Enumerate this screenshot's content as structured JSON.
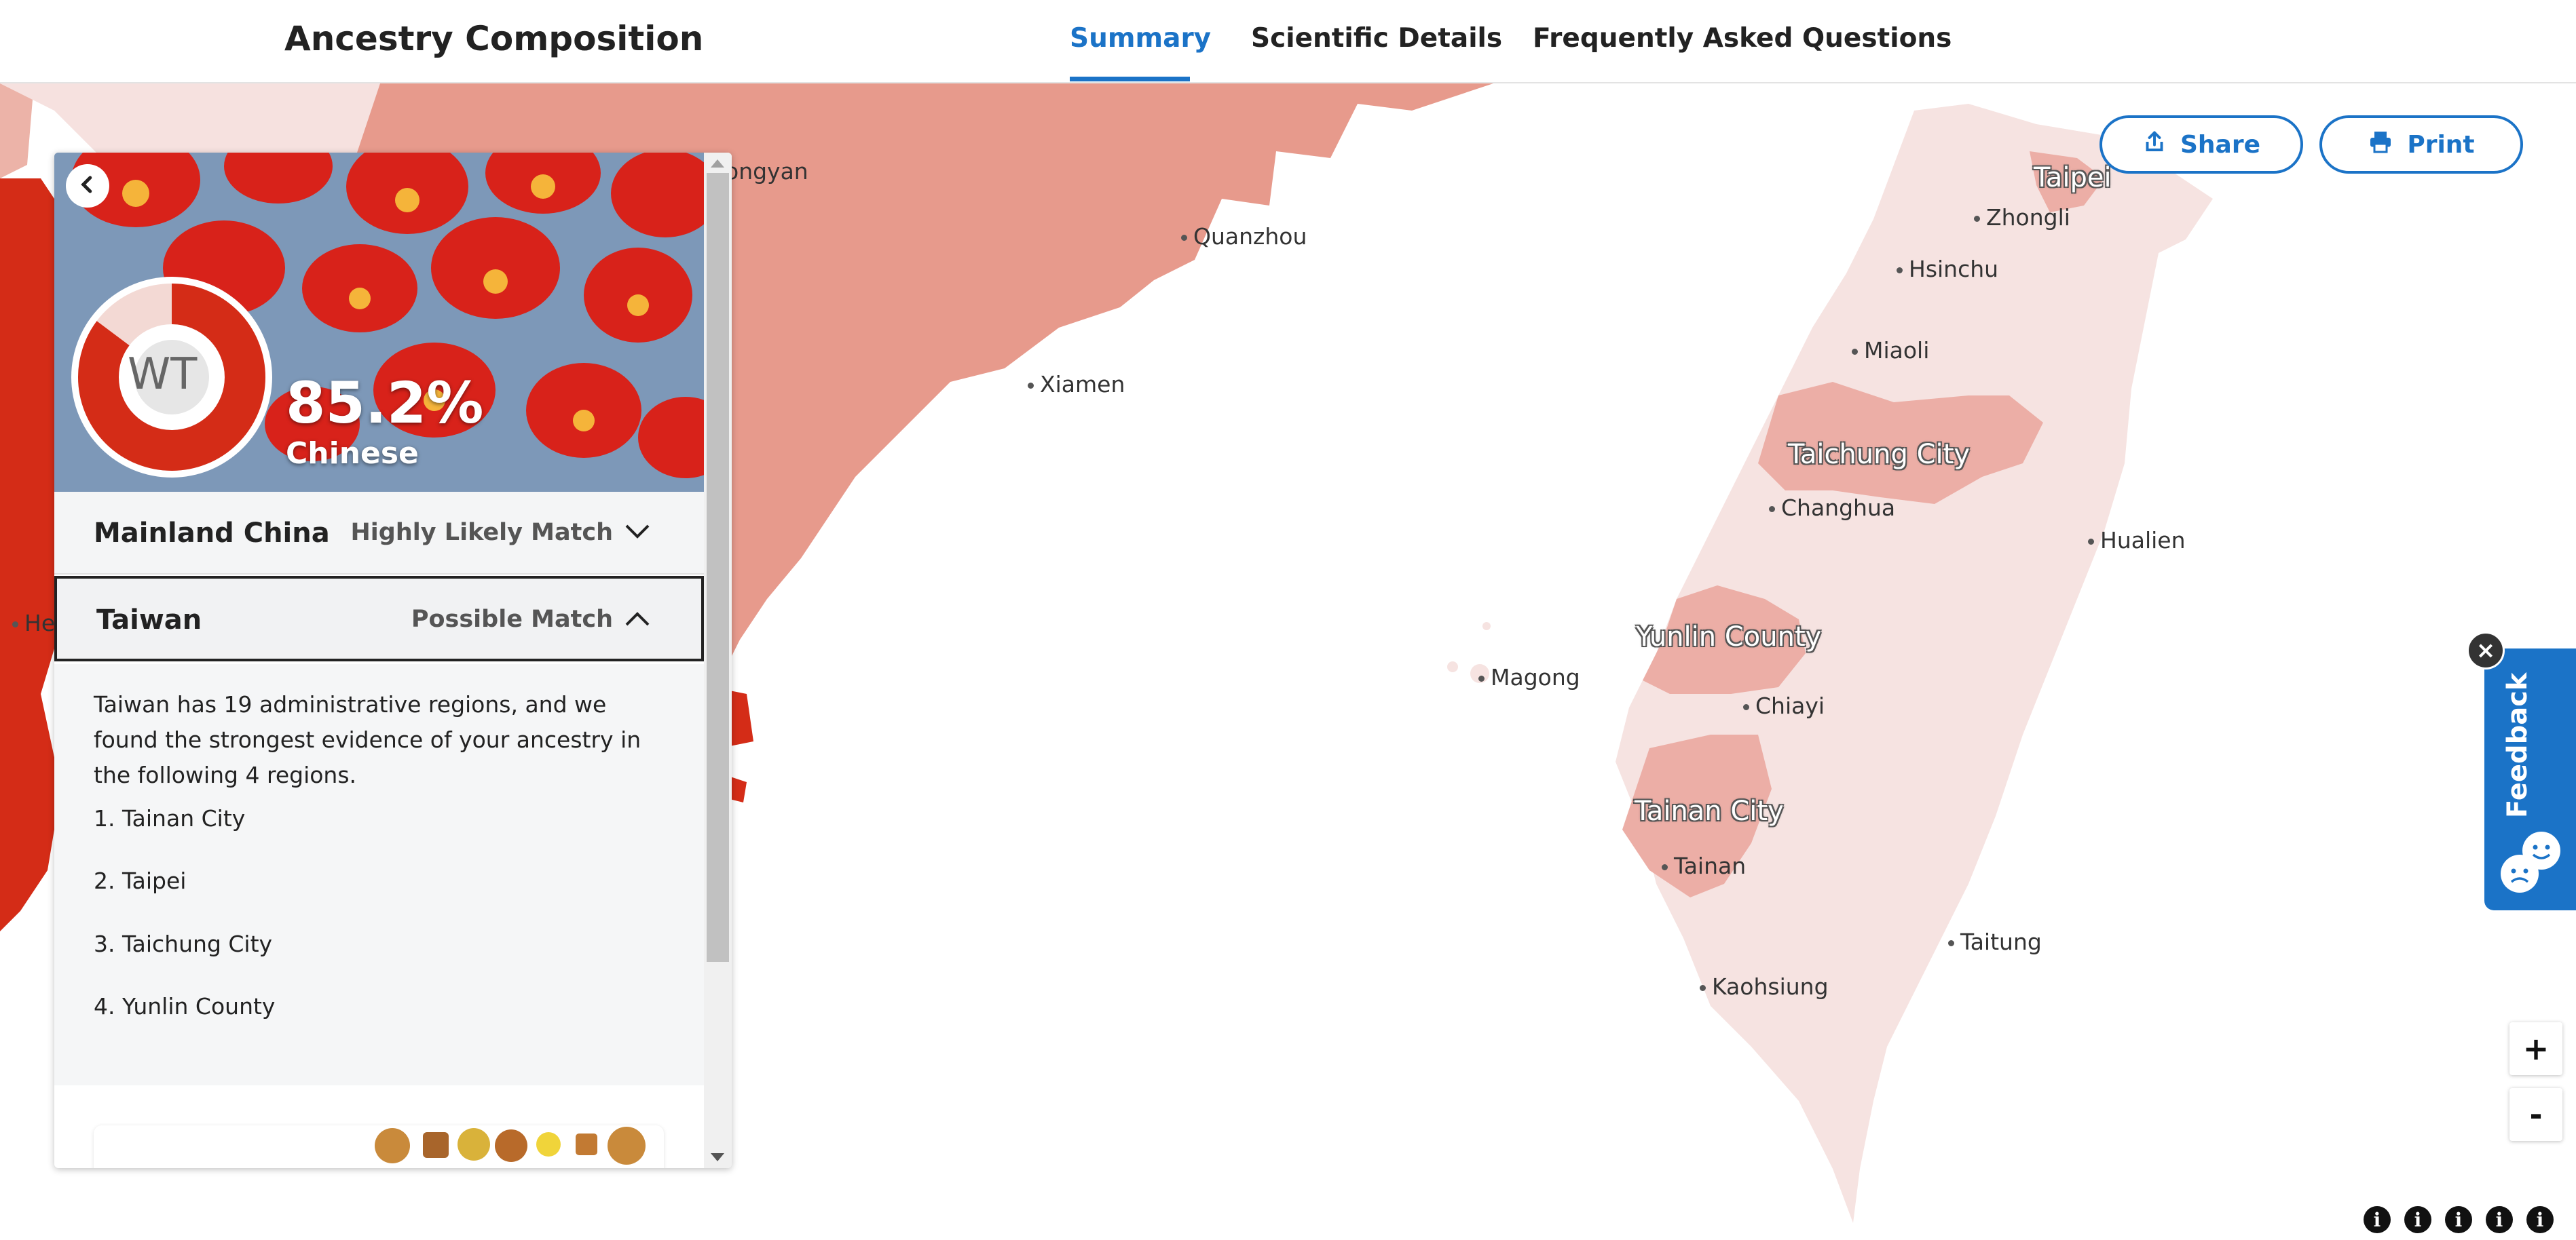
{
  "header": {
    "title": "Ancestry Composition",
    "tabs": [
      {
        "label": "Summary",
        "active": true
      },
      {
        "label": "Scientific Details",
        "active": false
      },
      {
        "label": "Frequently Asked Questions",
        "active": false
      }
    ]
  },
  "actions": {
    "share_label": "Share",
    "print_label": "Print"
  },
  "panel": {
    "avatar_initials": "WT",
    "percentage": "85.2%",
    "population": "Chinese",
    "percentage_value": 0.852,
    "rows": [
      {
        "name": "Mainland China",
        "match": "Highly Likely Match",
        "expanded": false
      },
      {
        "name": "Taiwan",
        "match": "Possible Match",
        "expanded": true
      }
    ],
    "taiwan_detail": {
      "description": "Taiwan has 19 administrative regions, and we found the strongest evidence of your ancestry in the following 4 regions.",
      "regions": [
        "1. Tainan City",
        "2. Taipei",
        "3. Taichung City",
        "4. Yunlin County"
      ]
    }
  },
  "map": {
    "cities": [
      "ongyan",
      "Quanzhou",
      "Xiamen",
      "He",
      "Zhongli",
      "Hsinchu",
      "Miaoli",
      "Changhua",
      "Hualien",
      "Magong",
      "Chiayi",
      "Tainan",
      "Taitung",
      "Kaohsiung"
    ],
    "highlighted_regions": [
      "Taipei",
      "Taichung City",
      "Yunlin County",
      "Tainan City"
    ]
  },
  "feedback": {
    "label": "Feedback",
    "close": "×"
  },
  "zoom": {
    "in": "+",
    "out": "-"
  },
  "info_icon_label": "i",
  "colors": {
    "accent": "#1b73c7",
    "mainland_fill": "#e79a8c",
    "taiwan_fill": "#f6e3e1",
    "region_highlight": "#ecaea6",
    "donut": "#d42c17"
  }
}
